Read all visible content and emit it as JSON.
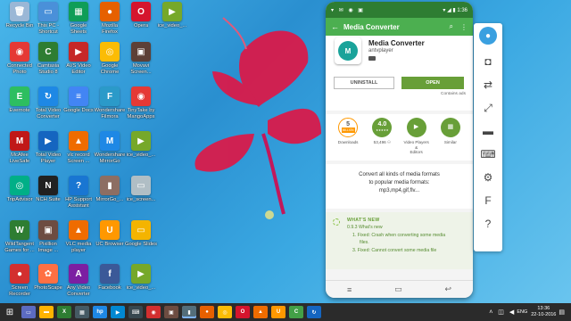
{
  "desktop_icons": [
    {
      "label": "Recycle Bin",
      "icon": "recycle-bin-icon",
      "color": "#9ab7d6",
      "glyph": "🗑"
    },
    {
      "label": "This PC -\nShortcut",
      "icon": "pc-icon",
      "color": "#4a90d9",
      "glyph": "▭"
    },
    {
      "label": "Google\nSheets",
      "icon": "sheets-icon",
      "color": "#0f9d58",
      "glyph": "▦"
    },
    {
      "label": "Mozilla\nFirefox",
      "icon": "firefox-icon",
      "color": "#e66000",
      "glyph": "●"
    },
    {
      "label": "Opera",
      "icon": "opera-icon",
      "color": "#d5152d",
      "glyph": "O"
    },
    {
      "label": "ice_video_...",
      "icon": "webm-icon",
      "color": "#76a82a",
      "glyph": "▶"
    },
    {
      "label": "Connected\nPhoto",
      "icon": "connected-photo-icon",
      "color": "#e53935",
      "glyph": "◉"
    },
    {
      "label": "Camtasia\nStudio 8",
      "icon": "camtasia-icon",
      "color": "#2e7d32",
      "glyph": "C"
    },
    {
      "label": "AVS Video\nEditor",
      "icon": "avs-icon",
      "color": "#c62828",
      "glyph": "▶"
    },
    {
      "label": "Google\nChrome",
      "icon": "chrome-icon",
      "color": "#fbbc05",
      "glyph": "◎"
    },
    {
      "label": "Movavi\nScreen...",
      "icon": "movavi-icon",
      "color": "#5d4037",
      "glyph": "▣"
    },
    {
      "label": "Evernote",
      "icon": "evernote-icon",
      "color": "#2dbe60",
      "glyph": "E"
    },
    {
      "label": "Total Video\nConverter",
      "icon": "total-video-converter-icon",
      "color": "#1e88e5",
      "glyph": "↻"
    },
    {
      "label": "Google Docs",
      "icon": "docs-icon",
      "color": "#4285f4",
      "glyph": "≡"
    },
    {
      "label": "Wondershare\nFilmora",
      "icon": "filmora-icon",
      "color": "#2b9ac9",
      "glyph": "F"
    },
    {
      "label": "TinyTake by\nMangoApps",
      "icon": "tinytake-icon",
      "color": "#e53935",
      "glyph": "◉"
    },
    {
      "label": "McAfee\nLiveSafe",
      "icon": "mcafee-icon",
      "color": "#c01818",
      "glyph": "M"
    },
    {
      "label": "Total Video\nPlayer",
      "icon": "total-video-player-icon",
      "color": "#1565c0",
      "glyph": "▶"
    },
    {
      "label": "vlc record\nScreen ...",
      "icon": "vlc-record-icon",
      "color": "#ef6c00",
      "glyph": "▲"
    },
    {
      "label": "Wondershare\nMirrorGo",
      "icon": "mirrorgo-icon",
      "color": "#1e88e5",
      "glyph": "M"
    },
    {
      "label": "ice_video_...",
      "icon": "webm-icon",
      "color": "#76a82a",
      "glyph": "▶"
    },
    {
      "label": "TripAdvisor",
      "icon": "tripadvisor-icon",
      "color": "#00af87",
      "glyph": "◎"
    },
    {
      "label": "NCH Suite",
      "icon": "nch-icon",
      "color": "#212121",
      "glyph": "N"
    },
    {
      "label": "HP Support\nAssistant",
      "icon": "help-icon",
      "color": "#1976d2",
      "glyph": "?"
    },
    {
      "label": "MirrorGo_...",
      "icon": "mirrorgo-file-icon",
      "color": "#8d6e63",
      "glyph": "▮"
    },
    {
      "label": "ice_screen...",
      "icon": "screenshot-file-icon",
      "color": "#b0bec5",
      "glyph": "▭"
    },
    {
      "label": "WildTangent\nGames for ...",
      "icon": "wildtangent-icon",
      "color": "#2e7d32",
      "glyph": "W"
    },
    {
      "label": "Pixillion\nImage ...",
      "icon": "pixillion-icon",
      "color": "#6d4c41",
      "glyph": "▣"
    },
    {
      "label": "VLC media\nplayer",
      "icon": "vlc-icon",
      "color": "#ef6c00",
      "glyph": "▲"
    },
    {
      "label": "UC Browser",
      "icon": "uc-browser-icon",
      "color": "#ff9800",
      "glyph": "U"
    },
    {
      "label": "Google Slides",
      "icon": "slides-icon",
      "color": "#f4b400",
      "glyph": "▭"
    },
    {
      "label": "Screen\nRecorder",
      "icon": "screen-recorder-icon",
      "color": "#d32f2f",
      "glyph": "●"
    },
    {
      "label": "PhotoScape",
      "icon": "photoscape-icon",
      "color": "#ff7043",
      "glyph": "✿"
    },
    {
      "label": "Any Video\nConverter",
      "icon": "any-video-converter-icon",
      "color": "#7b1fa2",
      "glyph": "A"
    },
    {
      "label": "Facebook",
      "icon": "facebook-icon",
      "color": "#3b5998",
      "glyph": "f"
    },
    {
      "label": "ice_video_...",
      "icon": "webm-icon",
      "color": "#76a82a",
      "glyph": "▶"
    }
  ],
  "phone": {
    "status_icons": "▾ ✉ ◉ ▣",
    "status_right": "▾ ◢ ▮ 1:36",
    "appbar_title": "Media Converter",
    "app_name": "Media Converter",
    "developer": "antvplayer",
    "logo_text": "M",
    "uninstall_label": "UNINSTALL",
    "open_label": "OPEN",
    "contains_ads": "Contains ads",
    "stats": [
      {
        "value": "5",
        "sub": "MILLION",
        "caption": "Downloads",
        "color": "#fff",
        "icon": "downloads-icon"
      },
      {
        "value": "4.0",
        "sub": "★★★★★",
        "caption": "53,496 ⚇",
        "color": "#689f38",
        "icon": "rating-icon"
      },
      {
        "value": "▶",
        "sub": "",
        "caption": "Video Players &\nEditors",
        "color": "#689f38",
        "icon": "video-category-icon"
      },
      {
        "value": "▦",
        "sub": "",
        "caption": "Similar",
        "color": "#689f38",
        "icon": "similar-icon"
      }
    ],
    "description": "Convert all kinds of media formats\nto popular media formats:\nmp3,mp4,gif,flv...",
    "whats_new_title": "WHAT'S NEW",
    "whats_new_lines": [
      "0.9.3 What's new",
      "1. Fixed: Crash when converting some media",
      "files.",
      "3. Fixed: Cannot convert some media file"
    ]
  },
  "taskbar": {
    "time": "13:36",
    "date": "22-10-2016",
    "lang": "ENG"
  },
  "colors": {
    "accent_green": "#4caf50",
    "status_green": "#2e7d32",
    "open_green": "#689f38",
    "taskbar": "#2b2b2b"
  }
}
